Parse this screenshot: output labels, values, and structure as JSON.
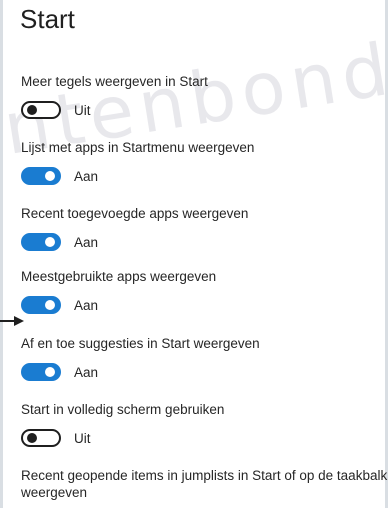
{
  "page": {
    "title": "Start"
  },
  "watermark": {
    "text": "ntenbond"
  },
  "settings": [
    {
      "label": "Meer tegels weergeven in Start",
      "state": "Uit",
      "on": false
    },
    {
      "label": "Lijst met apps in Startmenu weergeven",
      "state": "Aan",
      "on": true
    },
    {
      "label": "Recent toegevoegde apps weergeven",
      "state": "Aan",
      "on": true
    },
    {
      "label": "Meestgebruikte apps weergeven",
      "state": "Aan",
      "on": true
    },
    {
      "label": "Af en toe suggesties in Start weergeven",
      "state": "Aan",
      "on": true
    },
    {
      "label": "Start in volledig scherm gebruiken",
      "state": "Uit",
      "on": false
    },
    {
      "label": "Recent geopende items in jumplists in Start of op de taakbalk weergeven"
    }
  ],
  "colors": {
    "toggle_on": "#1a7cd1",
    "toggle_off_border": "#1f1f1f",
    "arrow": "#1f1f1f"
  }
}
